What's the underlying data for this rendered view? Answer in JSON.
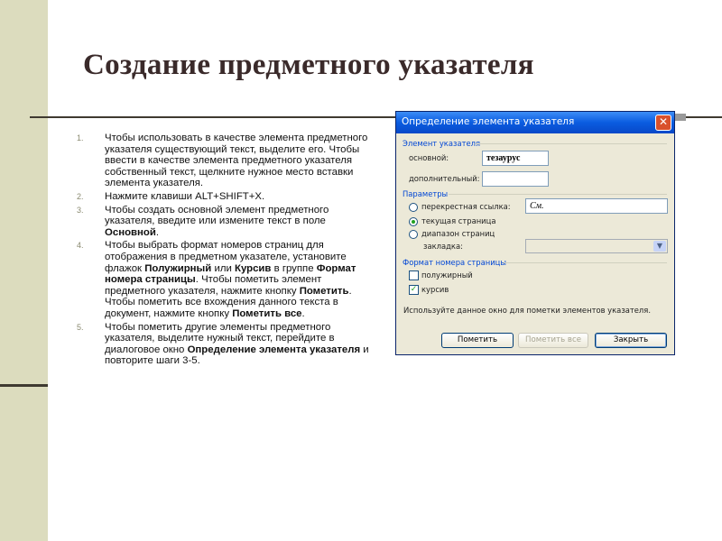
{
  "slide": {
    "title": "Создание предметного указателя",
    "steps": [
      {
        "num": "1.",
        "html": "Чтобы использовать в качестве элемента предметного указателя существующий текст, выделите его. Чтобы ввести в качестве элемента предметного указателя собственный текст, щелкните нужное место вставки элемента указателя."
      },
      {
        "num": "2.",
        "html": "Нажмите клавиши ALT+SHIFT+X."
      },
      {
        "num": "3.",
        "html": "Чтобы создать основной элемент предметного указателя, введите или измените текст в поле <b>Основной</b>."
      },
      {
        "num": "4.",
        "html": "Чтобы выбрать формат номеров страниц для отображения в предметном указателе, установите флажок <b>Полужирный</b> или <b>Курсив</b> в группе <b>Формат номера страницы</b>. Чтобы пометить элемент предметного указателя, нажмите кнопку <b>Пометить</b>. Чтобы пометить все вхождения данного текста в документ, нажмите кнопку <b>Пометить все</b>."
      },
      {
        "num": "5.",
        "html": "Чтобы пометить другие элементы предметного указателя, выделите нужный текст, перейдите в диалоговое окно <b>Определение элемента указателя</b> и повторите шаги 3-5."
      }
    ]
  },
  "dialog": {
    "title": "Определение элемента указателя",
    "close_icon": "close-icon",
    "entry_group": "Элемент указателя",
    "main_label": "основной:",
    "main_value": "тезаурус",
    "sub_label": "дополнительный:",
    "sub_value": "",
    "options_group": "Параметры",
    "opt_cross": "перекрестная ссылка:",
    "cross_value": "См.",
    "opt_current": "текущая страница",
    "opt_range": "диапазон страниц",
    "bookmark_label": "закладка:",
    "bookmark_value": "",
    "format_group": "Формат номера страницы",
    "bold_label": "полужирный",
    "italic_label": "курсив",
    "hint": "Используйте данное окно для пометки элементов указателя.",
    "btn_mark": "Пометить",
    "btn_mark_all": "Пометить все",
    "btn_close": "Закрыть",
    "state": {
      "selected_option": "current",
      "bold_checked": false,
      "italic_checked": true
    },
    "colors": {
      "title_bar": "#0a5ce0",
      "group_label": "#0046d5",
      "close": "#d9512c"
    }
  }
}
